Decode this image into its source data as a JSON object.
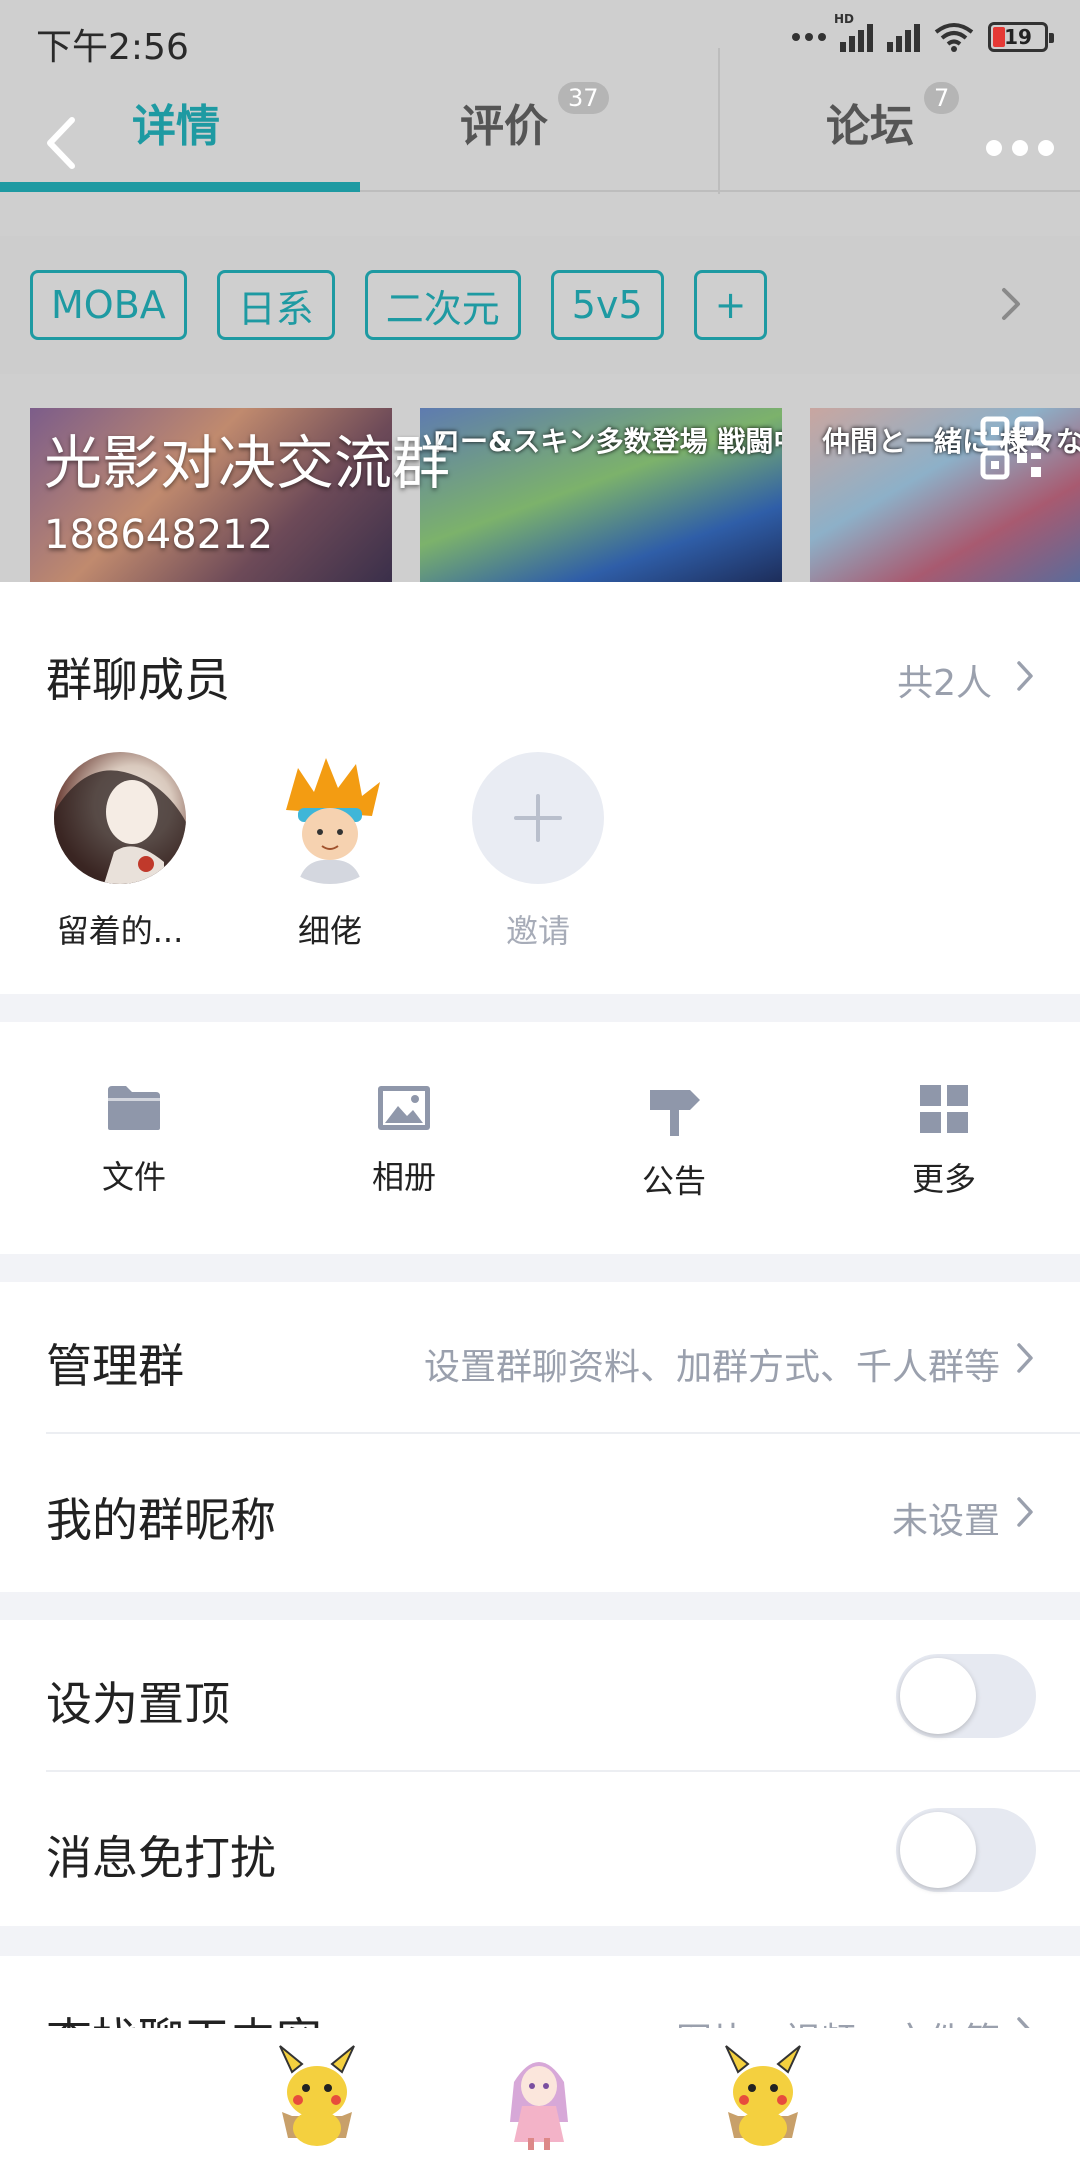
{
  "status": {
    "time": "下午2:56",
    "hd": "HD",
    "battery": "19"
  },
  "tabs": [
    {
      "label": "详情",
      "badge": ""
    },
    {
      "label": "评价",
      "badge": "37"
    },
    {
      "label": "论坛",
      "badge": "7"
    }
  ],
  "tags": [
    "MOBA",
    "日系",
    "二次元",
    "5v5",
    "+"
  ],
  "banner": {
    "title": "光影对决交流群",
    "group_id": "188648212",
    "shot_texts": [
      "",
      "ロー&スキン多数登場 戦闘中で自由変換可能!",
      "仲間と一緒に 様々なプレイ"
    ]
  },
  "members": {
    "title": "群聊成员",
    "count": "共2人",
    "list": [
      {
        "name": "留着的..."
      },
      {
        "name": "细佬"
      },
      {
        "name": "邀请"
      }
    ]
  },
  "tools": [
    {
      "label": "文件",
      "icon": "folder-icon"
    },
    {
      "label": "相册",
      "icon": "image-icon"
    },
    {
      "label": "公告",
      "icon": "signpost-icon"
    },
    {
      "label": "更多",
      "icon": "grid-icon"
    }
  ],
  "settings": {
    "manage": {
      "title": "管理群",
      "value": "设置群聊资料、加群方式、千人群等"
    },
    "nickname": {
      "title": "我的群昵称",
      "value": "未设置"
    },
    "pin": {
      "title": "设为置顶",
      "on": false
    },
    "mute": {
      "title": "消息免打扰",
      "on": false
    },
    "search": {
      "title": "查找聊天内容",
      "value": "图片、视频、文件等"
    }
  },
  "colors": {
    "accent": "#1e9aa2",
    "muted": "#9aa0ad",
    "toggle_off": "#e6e9f1"
  }
}
